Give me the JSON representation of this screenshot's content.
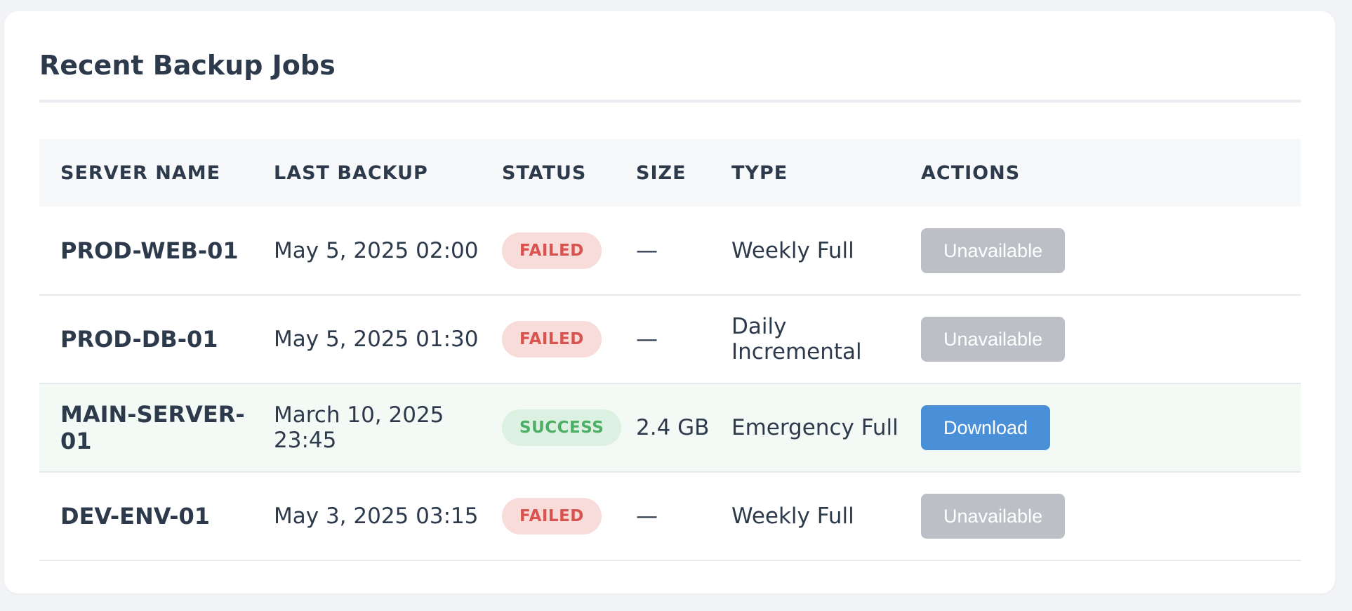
{
  "title": "Recent Backup Jobs",
  "columns": [
    "SERVER NAME",
    "LAST BACKUP",
    "STATUS",
    "SIZE",
    "TYPE",
    "ACTIONS"
  ],
  "rows": [
    {
      "server": "PROD-WEB-01",
      "last_backup": "May 5, 2025 02:00",
      "status": "FAILED",
      "size": "—",
      "type": "Weekly Full",
      "action": "Unavailable",
      "action_enabled": false
    },
    {
      "server": "PROD-DB-01",
      "last_backup": "May 5, 2025 01:30",
      "status": "FAILED",
      "size": "—",
      "type": "Daily Incremental",
      "action": "Unavailable",
      "action_enabled": false
    },
    {
      "server": "MAIN-SERVER-01",
      "last_backup": "March 10, 2025 23:45",
      "status": "SUCCESS",
      "size": "2.4 GB",
      "type": "Emergency Full",
      "action": "Download",
      "action_enabled": true
    },
    {
      "server": "DEV-ENV-01",
      "last_backup": "May 3, 2025 03:15",
      "status": "FAILED",
      "size": "—",
      "type": "Weekly Full",
      "action": "Unavailable",
      "action_enabled": false
    }
  ],
  "colors": {
    "text": "#2d3a4c",
    "failed_bg": "#f7dcda",
    "failed_text": "#d9534f",
    "success_bg": "#dcf1e2",
    "success_text": "#4caf64",
    "success_row_bg": "#f3f9f4",
    "button_primary": "#4a90d9",
    "button_disabled": "#bcc0c6"
  }
}
